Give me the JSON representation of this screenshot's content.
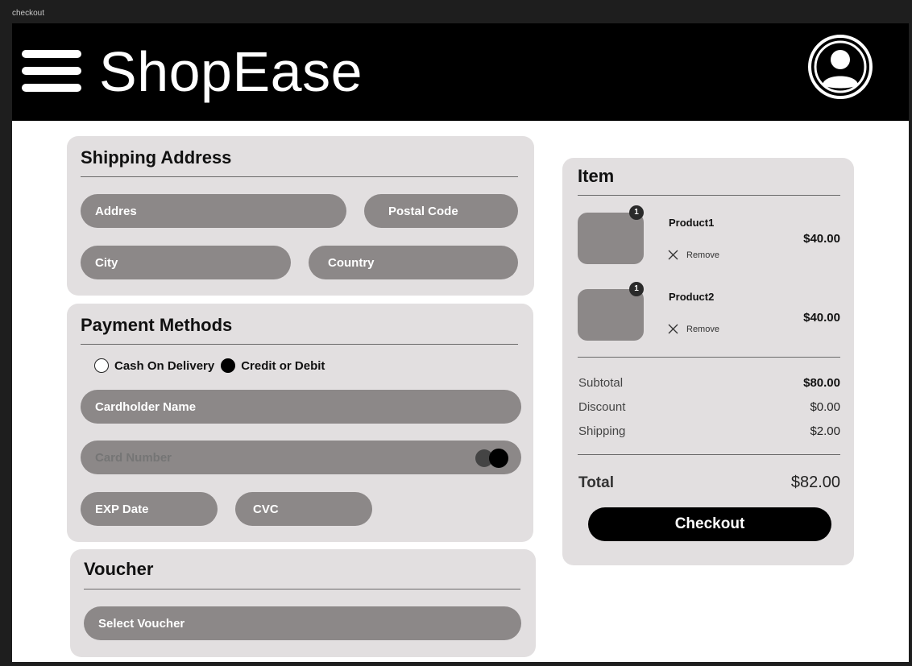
{
  "window": {
    "title": "checkout"
  },
  "header": {
    "brand": "ShopEase",
    "menu_icon": "hamburger-menu-icon",
    "profile_icon": "user-profile-icon"
  },
  "shipping": {
    "title": "Shipping Address",
    "address_placeholder": "Addres",
    "postal_placeholder": "Postal Code",
    "city_placeholder": "City",
    "country_placeholder": "Country"
  },
  "payment": {
    "title": "Payment Methods",
    "options": [
      {
        "label": "Cash On Delivery",
        "selected": false
      },
      {
        "label": "Credit or Debit",
        "selected": true
      }
    ],
    "cardholder_placeholder": "Cardholder Name",
    "card_number_placeholder": "Card Number",
    "exp_placeholder": "EXP Date",
    "cvc_placeholder": "CVC",
    "card_icon": "card-brand-icon"
  },
  "voucher": {
    "title": "Voucher",
    "select_placeholder": "Select Voucher"
  },
  "order": {
    "title": "Item",
    "items": [
      {
        "name": "Product1",
        "qty": "1",
        "price": "$40.00",
        "remove_label": "Remove"
      },
      {
        "name": "Product2",
        "qty": "1",
        "price": "$40.00",
        "remove_label": "Remove"
      }
    ],
    "summary": {
      "subtotal_label": "Subtotal",
      "subtotal": "$80.00",
      "discount_label": "Discount",
      "discount": "$0.00",
      "shipping_label": "Shipping",
      "shipping": "$2.00"
    },
    "total_label": "Total",
    "total": "$82.00",
    "checkout_label": "Checkout"
  },
  "colors": {
    "header_bg": "#000000",
    "card_bg": "#e2dfe0",
    "field_bg": "#8c8888",
    "button_bg": "#000000"
  }
}
